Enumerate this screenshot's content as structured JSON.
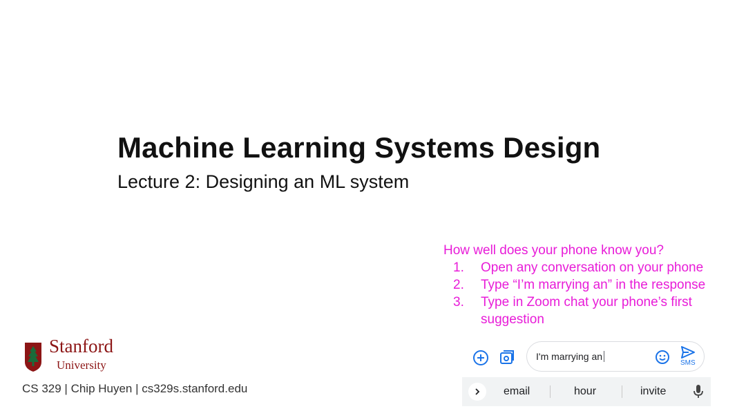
{
  "slide": {
    "title": "Machine Learning Systems Design",
    "subtitle": "Lecture 2: Designing an ML system"
  },
  "instructions": {
    "heading": "How well does your phone know you?",
    "steps": [
      {
        "num": "1.",
        "text": "Open any conversation on your phone"
      },
      {
        "num": "2.",
        "text": "Type “I’m marrying an” in the response"
      },
      {
        "num": "3.",
        "text": "Type in Zoom chat your phone’s first suggestion"
      }
    ],
    "color": "#e81cd8"
  },
  "logo": {
    "wordmark": "Stanford",
    "university": "University",
    "color": "#8c1515"
  },
  "footer": {
    "text": "CS 329 | Chip Huyen | cs329s.stanford.edu"
  },
  "phone": {
    "input_text": "I'm marrying an",
    "send_label": "SMS",
    "suggestions": [
      "email",
      "hour",
      "invite"
    ],
    "icons": [
      "add-circle-icon",
      "gallery-icon",
      "emoji-icon",
      "send-icon",
      "chevron-right-icon",
      "microphone-icon"
    ],
    "accent": "#1a73e8"
  }
}
